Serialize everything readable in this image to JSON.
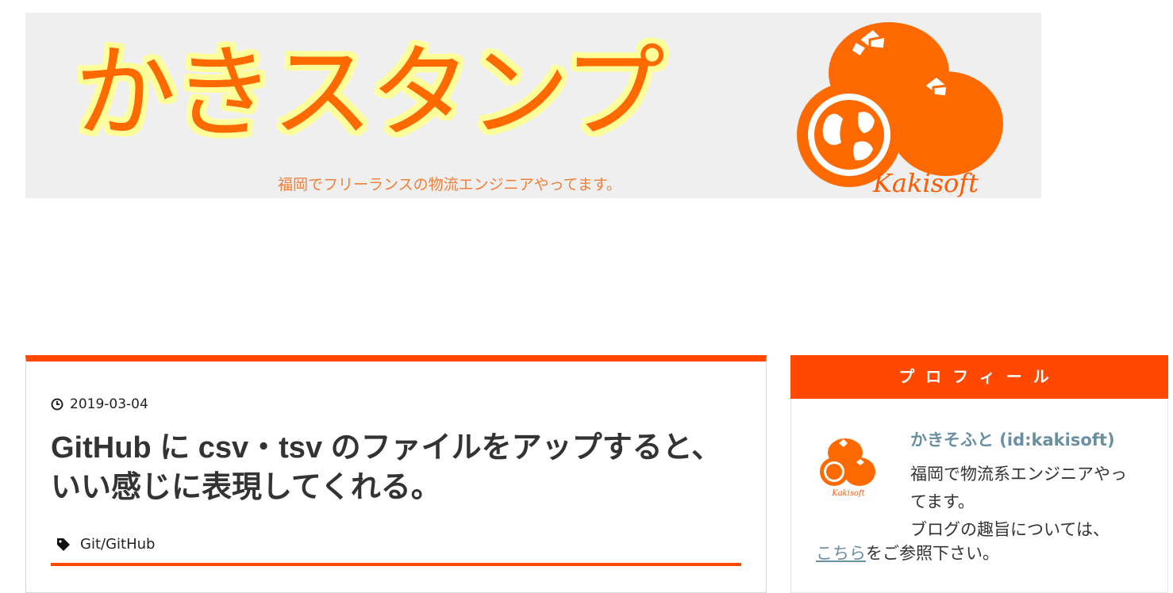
{
  "banner": {
    "title": "かきスタンプ",
    "tagline": "福岡でフリーランスの物流エンジニアやってます。",
    "logo_text": "Kakisoft"
  },
  "colors": {
    "accent": "#ff4800",
    "banner_text": "#ff6a00",
    "banner_outline": "#ffff99",
    "banner_bg": "#efefef",
    "link": "#6a8fa2"
  },
  "article": {
    "date": "2019-03-04",
    "title": "GitHub に csv・tsv のファイルをアップすると、いい感じに表現してくれる。",
    "category": "Git/GitHub",
    "icons": {
      "date": "clock-icon",
      "category": "tag-icon"
    }
  },
  "sidebar": {
    "profile": {
      "header": "プロフィール",
      "name": "かきそふと (id:kakisoft)",
      "description": "福岡で物流系エンジニアやってます。\nブログの趣旨については、",
      "link_text": "こちら",
      "link_suffix": "をご参照下さい。"
    }
  }
}
